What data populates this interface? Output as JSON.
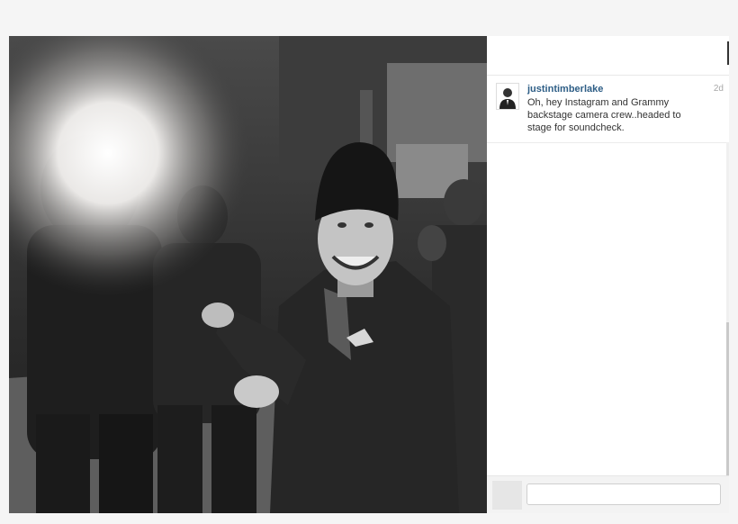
{
  "post": {
    "username": "justintimberlake",
    "time_ago": "2d",
    "caption": "Oh, hey Instagram and Grammy backstage camera crew..headed to stage for soundcheck."
  },
  "comment_box": {
    "placeholder": ""
  },
  "icons": {
    "avatar": "avatar-icon",
    "like": "like-icon"
  },
  "colors": {
    "username": "#2e5e86",
    "time": "#a8a8a8",
    "caption": "#333333"
  }
}
